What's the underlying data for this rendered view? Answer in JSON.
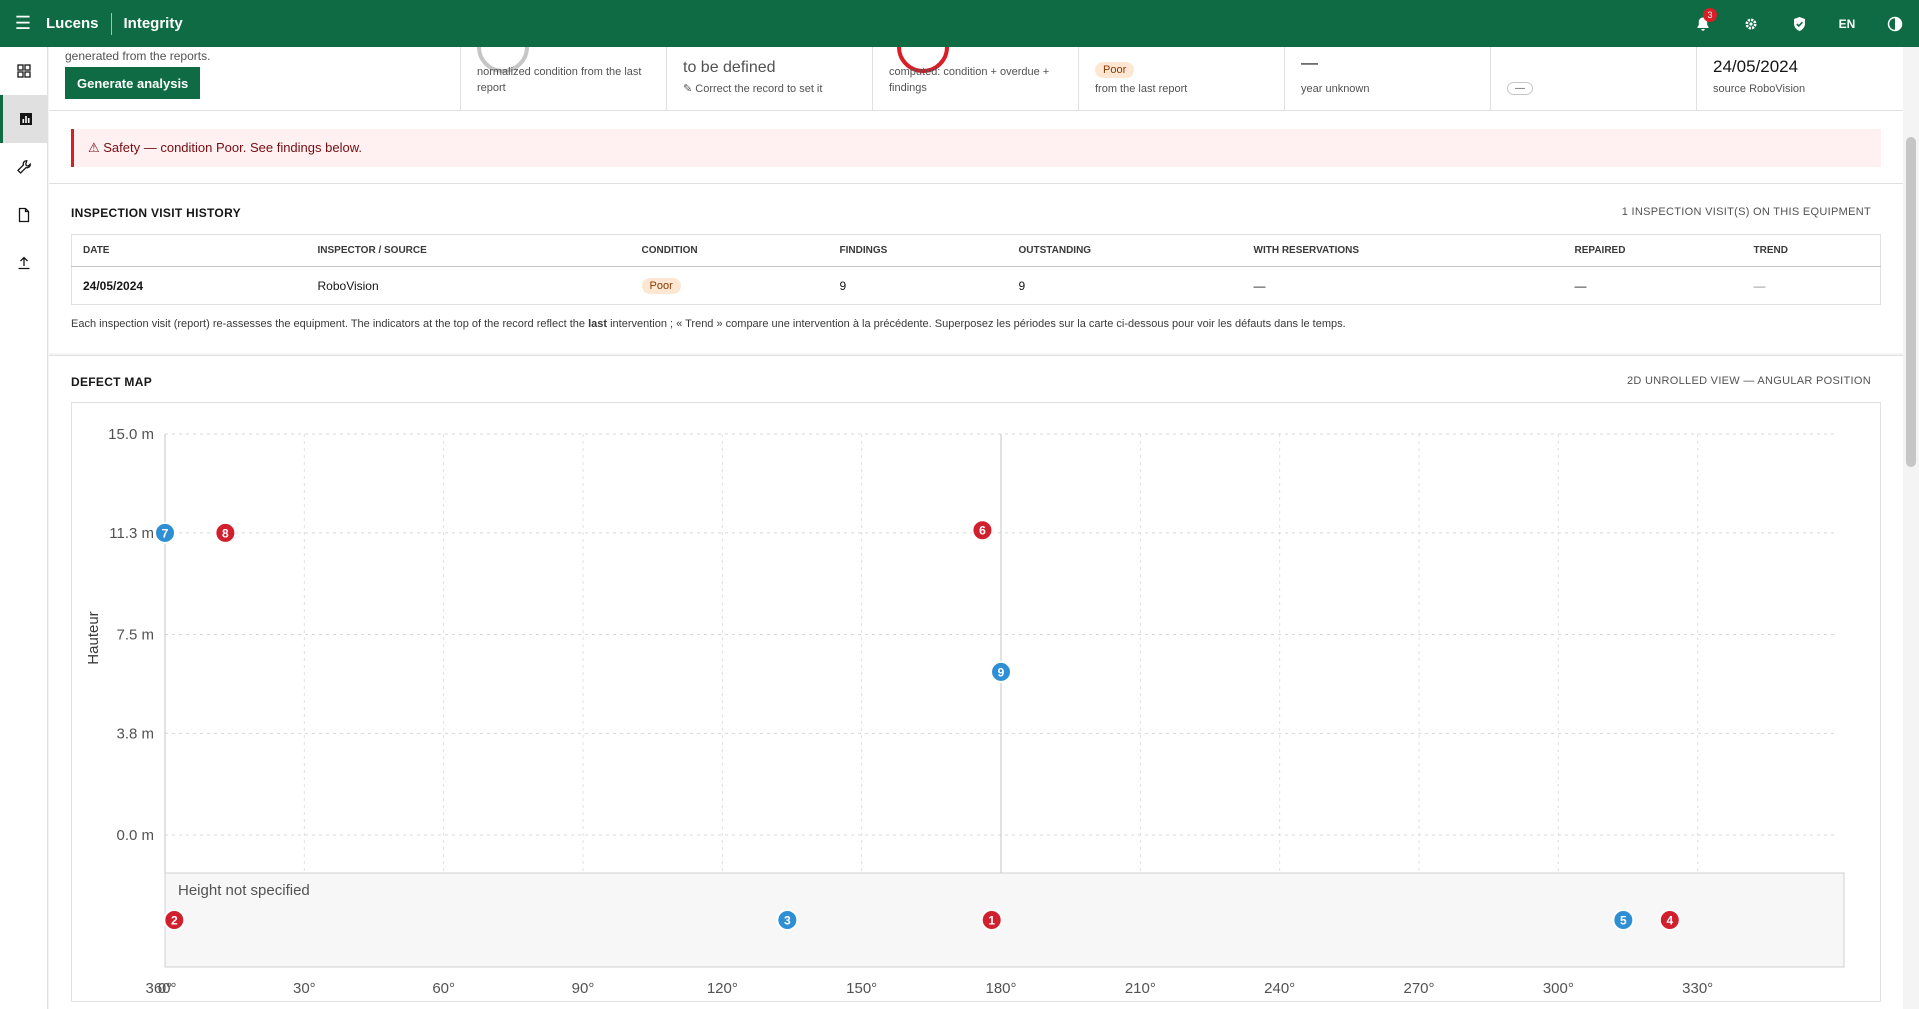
{
  "header": {
    "brand": "Lucens",
    "app": "Integrity",
    "notification_count": "3",
    "language": "EN"
  },
  "kpis": {
    "intro_text": "generated from the reports.",
    "generate_label": "Generate analysis",
    "condition_sub": "normalized condition from the last report",
    "criticality_value": "to be defined",
    "criticality_sub": "✎ Correct the record to set it",
    "risk_sub": "computed: condition + overdue + findings",
    "status_pill": "Poor",
    "status_sub": "from the last report",
    "year_value": "—",
    "year_sub": "year unknown",
    "extra_pill": "—",
    "last_date": "24/05/2024",
    "last_source": "source RoboVision"
  },
  "alert": {
    "text": "⚠ Safety — condition Poor. See findings below."
  },
  "history": {
    "title": "INSPECTION VISIT HISTORY",
    "count": "1 INSPECTION VISIT(S) ON THIS EQUIPMENT",
    "columns": [
      "DATE",
      "INSPECTOR / SOURCE",
      "CONDITION",
      "FINDINGS",
      "OUTSTANDING",
      "WITH RESERVATIONS",
      "REPAIRED",
      "TREND"
    ],
    "rows": [
      {
        "date": "24/05/2024",
        "source": "RoboVision",
        "condition": "Poor",
        "findings": "9",
        "outstanding": "9",
        "reservations": "—",
        "repaired": "—",
        "trend": "—"
      }
    ],
    "note_before": "Each inspection visit (report) re-assesses the equipment. The indicators at the top of the record reflect the ",
    "note_bold": "last",
    "note_after": " intervention ; « Trend » compare une intervention à la précédente. Superposez les périodes sur la carte ci-dessous pour voir les défauts dans le temps."
  },
  "defect_map": {
    "title": "DEFECT MAP",
    "view": "2D UNROLLED VIEW — ANGULAR POSITION"
  },
  "chart_data": {
    "type": "scatter",
    "ylabel": "Hauteur",
    "y_ticks": [
      "15.0 m",
      "11.3 m",
      "7.5 m",
      "3.8 m",
      "0.0 m"
    ],
    "y_tick_values": [
      15.0,
      11.3,
      7.5,
      3.8,
      0.0
    ],
    "x_ticks": [
      "360°",
      "0°",
      "30°",
      "60°",
      "90°",
      "120°",
      "150°",
      "180°",
      "210°",
      "240°",
      "270°",
      "300°",
      "330°"
    ],
    "x_tick_values": [
      360,
      0,
      30,
      60,
      90,
      120,
      150,
      180,
      210,
      240,
      270,
      300,
      330
    ],
    "xlim": [
      0,
      360
    ],
    "ylim": [
      0,
      15
    ],
    "unspecified_label": "Height not specified",
    "colors": {
      "red": "#d0202e",
      "blue": "#2f8fd4"
    },
    "points": [
      {
        "id": "1",
        "angle": 178,
        "height": null,
        "color": "red"
      },
      {
        "id": "2",
        "angle": 2,
        "height": null,
        "color": "red"
      },
      {
        "id": "3",
        "angle": 134,
        "height": null,
        "color": "blue"
      },
      {
        "id": "4",
        "angle": 324,
        "height": null,
        "color": "red"
      },
      {
        "id": "5",
        "angle": 314,
        "height": null,
        "color": "blue"
      },
      {
        "id": "6",
        "angle": 176,
        "height": 11.4,
        "color": "red"
      },
      {
        "id": "7",
        "angle": 0,
        "height": 11.3,
        "color": "blue"
      },
      {
        "id": "8",
        "angle": 13,
        "height": 11.3,
        "color": "red"
      },
      {
        "id": "9",
        "angle": 180,
        "height": 6.1,
        "color": "blue"
      }
    ]
  }
}
